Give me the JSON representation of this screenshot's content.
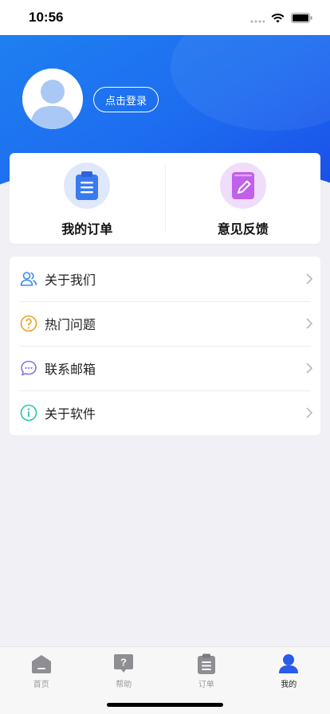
{
  "status_bar": {
    "time": "10:56"
  },
  "profile": {
    "login_label": "点击登录"
  },
  "quick_actions": [
    {
      "label": "我的订单",
      "icon": "clipboard-icon",
      "color": "#3a7af0"
    },
    {
      "label": "意见反馈",
      "icon": "pencil-icon",
      "color": "#c160ea"
    }
  ],
  "menu": {
    "items": [
      {
        "label": "关于我们",
        "icon": "people-icon",
        "color": "#3a8af0"
      },
      {
        "label": "热门问题",
        "icon": "question-icon",
        "color": "#f0a020"
      },
      {
        "label": "联系邮箱",
        "icon": "chat-icon",
        "color": "#8b6fe8"
      },
      {
        "label": "关于软件",
        "icon": "info-icon",
        "color": "#23c9a8"
      }
    ]
  },
  "tabbar": {
    "tabs": [
      {
        "label": "首页",
        "icon": "home-icon",
        "active": false
      },
      {
        "label": "帮助",
        "icon": "help-icon",
        "active": false
      },
      {
        "label": "订单",
        "icon": "orders-icon",
        "active": false
      },
      {
        "label": "我的",
        "icon": "profile-icon",
        "active": true
      }
    ]
  },
  "colors": {
    "header": "#1d6cf0",
    "active_tab": "#2a5bea",
    "inactive_tab": "#999999"
  }
}
